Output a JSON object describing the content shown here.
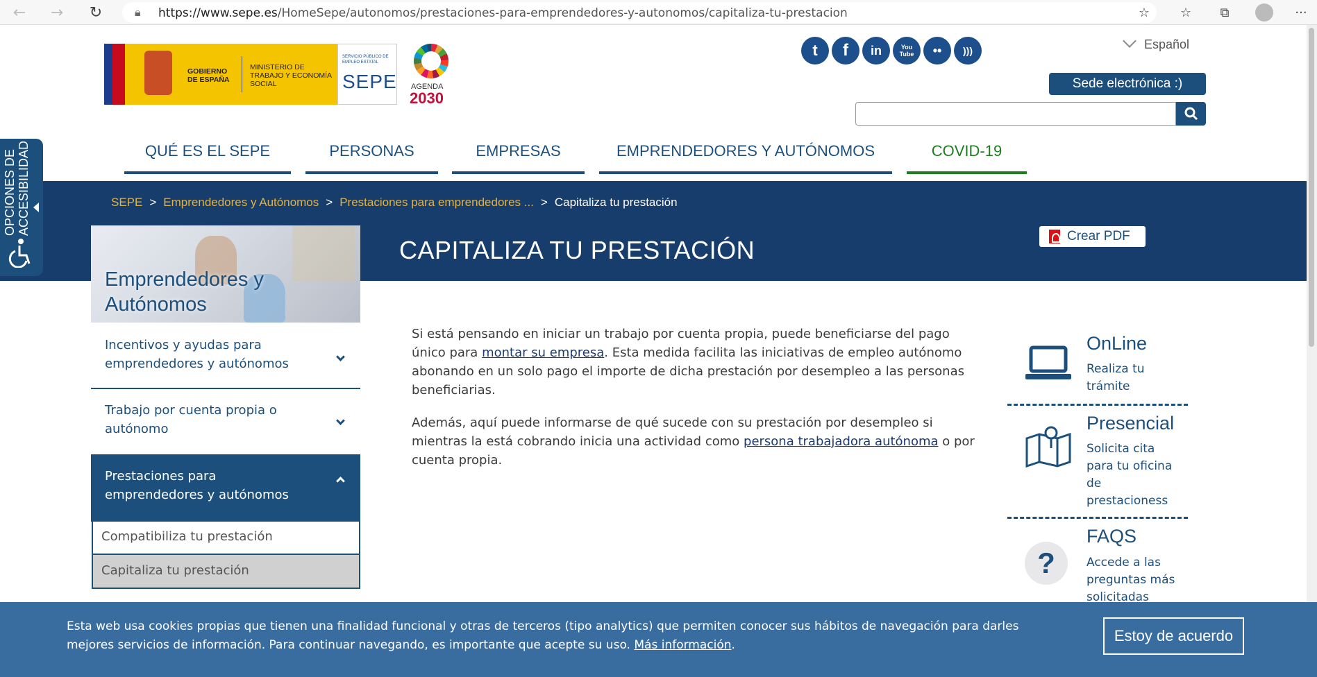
{
  "browser": {
    "url_host": "https://www.sepe.es",
    "url_path": "/HomeSepe/autonomos/prestaciones-para-emprendedores-y-autonomos/capitaliza-tu-prestacion"
  },
  "header": {
    "gov_text": "GOBIERNO DE ESPAÑA",
    "ministry_text": "MINISTERIO DE TRABAJO Y ECONOMÍA SOCIAL",
    "sepe_small": "SERVICIO PÚBLICO DE EMPLEO ESTATAL",
    "sepe_big": "SEPE",
    "agenda_label": "AGENDA",
    "agenda_year": "2030",
    "language": "Español",
    "sede_label": "Sede electrónica  :)",
    "search_placeholder": ""
  },
  "social": [
    {
      "name": "twitter-icon",
      "glyph": "t"
    },
    {
      "name": "facebook-icon",
      "glyph": "f"
    },
    {
      "name": "linkedin-icon",
      "glyph": "in"
    },
    {
      "name": "youtube-icon",
      "glyph": "You Tube"
    },
    {
      "name": "flickr-icon",
      "glyph": "••"
    },
    {
      "name": "rss-icon",
      "glyph": ")))"
    }
  ],
  "nav": {
    "items": [
      {
        "label": "QUÉ ES EL SEPE"
      },
      {
        "label": "PERSONAS"
      },
      {
        "label": "EMPRESAS"
      },
      {
        "label": "EMPRENDEDORES Y AUTÓNOMOS"
      },
      {
        "label": "COVID-19"
      }
    ]
  },
  "breadcrumb": {
    "items": [
      "SEPE",
      "Emprendedores y Autónomos",
      "Prestaciones para emprendedores ..."
    ],
    "current": "Capitaliza tu prestación"
  },
  "page": {
    "title": "CAPITALIZA TU PRESTACIÓN",
    "pdf_label": "Crear PDF"
  },
  "accessibility": {
    "label_line1": "OPCIONES DE",
    "label_line2": "ACCESIBILIDAD"
  },
  "sidebar": {
    "title": "Emprendedores y Autónomos",
    "items": [
      {
        "label": "Incentivos y ayudas para emprendedores y autónomos"
      },
      {
        "label": "Trabajo por cuenta propia o autónomo"
      },
      {
        "label": "Prestaciones para emprendedores y autónomos"
      }
    ],
    "subitems": [
      {
        "label": "Compatibiliza tu prestación"
      },
      {
        "label": "Capitaliza tu prestación"
      }
    ]
  },
  "main": {
    "p1_a": "Si está pensando en iniciar un trabajo por cuenta propia, puede beneficiarse del pago único para ",
    "p1_link": "montar su empresa",
    "p1_b": ". Esta medida facilita las iniciativas de empleo autónomo abonando en un solo pago el importe de dicha prestación por desempleo a las personas beneficiarias.",
    "p2_a": "Además, aquí puede informarse de qué sucede con su prestación por desempleo si mientras la está cobrando inicia una actividad como ",
    "p2_link": "persona trabajadora autónoma",
    "p2_b": " o por cuenta propia."
  },
  "right_column": [
    {
      "title": "OnLine",
      "text": "Realiza tu trámite"
    },
    {
      "title": "Presencial",
      "text": "Solicita cita para tu oficina de prestacioness"
    },
    {
      "title": "FAQS",
      "text": "Accede a las preguntas más solicitadas"
    }
  ],
  "cookie": {
    "text": "Esta web usa cookies propias que tienen una finalidad funcional y otras de terceros (tipo analytics) que permiten conocer sus hábitos de navegación para darles mejores servicios de información. Para continuar navegando, es importante que acepte su uso. ",
    "link": "Más información",
    "end": ".",
    "button": "Estoy de acuerdo"
  },
  "colors": {
    "primary_blue": "#1d4f7c",
    "band_blue": "#163d6b",
    "breadcrumb_gold": "#e0b24a",
    "covid_green": "#1e7e1e",
    "cookie_blue": "#3a6d9f"
  }
}
